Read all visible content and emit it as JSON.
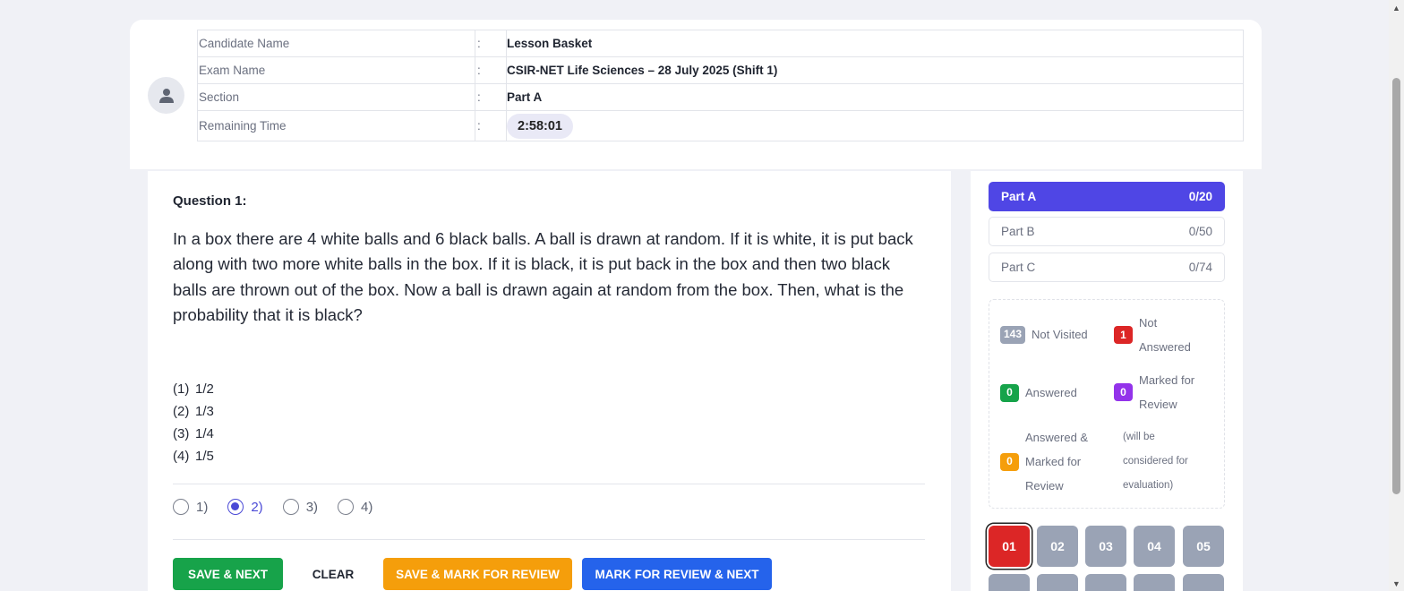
{
  "header": {
    "rows": [
      {
        "label": "Candidate Name",
        "sep": ":",
        "value": "Lesson Basket"
      },
      {
        "label": "Exam Name",
        "sep": ":",
        "value": "CSIR-NET Life Sciences – 28 July 2025 (Shift 1)"
      },
      {
        "label": "Section",
        "sep": ":",
        "value": "Part A"
      },
      {
        "label": "Remaining Time",
        "sep": ":",
        "value": "2:58:01"
      }
    ]
  },
  "question": {
    "title": "Question 1:",
    "text": "In a box there are 4 white balls and 6 black balls. A ball is drawn at random. If it is white, it is put back along with two more white balls in the box. If it is black, it is put back in the box and then two black balls are thrown out of the box. Now a ball is drawn again at random from the box. Then, what is the probability that it is black?",
    "options": [
      {
        "num": "(1)",
        "text": "1/2"
      },
      {
        "num": "(2)",
        "text": "1/3"
      },
      {
        "num": "(3)",
        "text": "1/4"
      },
      {
        "num": "(4)",
        "text": "1/5"
      }
    ],
    "answers": [
      {
        "label": "1)",
        "checked": false
      },
      {
        "label": "2)",
        "checked": true
      },
      {
        "label": "3)",
        "checked": false
      },
      {
        "label": "4)",
        "checked": false
      }
    ]
  },
  "actions": {
    "save_next": "SAVE & NEXT",
    "clear": "CLEAR",
    "save_mark": "SAVE & MARK FOR REVIEW",
    "mark_next": "MARK FOR REVIEW & NEXT"
  },
  "parts": [
    {
      "name": "Part A",
      "count": "0/20",
      "active": true
    },
    {
      "name": "Part B",
      "count": "0/50",
      "active": false
    },
    {
      "name": "Part C",
      "count": "0/74",
      "active": false
    }
  ],
  "legend": {
    "not_visited": {
      "count": "143",
      "label": "Not Visited"
    },
    "not_answered": {
      "count": "1",
      "label_1": "Not",
      "label_2": "Answered"
    },
    "answered": {
      "count": "0",
      "label": "Answered"
    },
    "marked": {
      "count": "0",
      "label_1": "Marked for",
      "label_2": "Review"
    },
    "answered_marked": {
      "count": "0",
      "label_1": "Answered &",
      "label_2": "Marked for",
      "label_3": "Review"
    },
    "note": {
      "line_1": "(will be",
      "line_2": "considered for",
      "line_3": "evaluation)"
    }
  },
  "question_numbers": [
    "01",
    "02",
    "03",
    "04",
    "05"
  ],
  "colors": {
    "accent": "#4f46e5",
    "green": "#17a34a",
    "orange": "#f59e0b",
    "blue": "#2563eb",
    "red": "#dc2626",
    "purple": "#9333ea",
    "gray": "#9aa3b5"
  },
  "icons": {
    "avatar": "user-icon",
    "scroll_up": "chevron-up-icon",
    "scroll_down": "chevron-down-icon"
  }
}
